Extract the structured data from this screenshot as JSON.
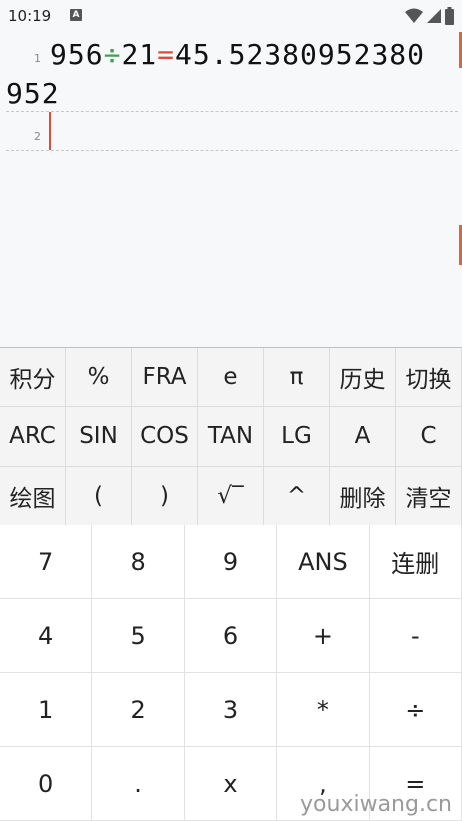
{
  "status_bar": {
    "time": "10:19",
    "notification_icon": "A",
    "icons": [
      "wifi-icon",
      "signal-icon",
      "battery-icon"
    ]
  },
  "editor": {
    "line1_number": "1",
    "line1_operand1": "956",
    "line1_op": "÷",
    "line1_operand2": "21",
    "line1_eq": "=",
    "line1_result_part1": "45.52380952380",
    "line1_result_part2": "952",
    "line2_number": "2",
    "colors": {
      "divide": "#3fa34d",
      "equals": "#e04a3a",
      "cursor": "#e04a3a"
    }
  },
  "function_keys": [
    [
      "积分",
      "%",
      "FRA",
      "e",
      "π",
      "历史",
      "切换"
    ],
    [
      "ARC",
      "SIN",
      "COS",
      "TAN",
      "LG",
      "A",
      "C"
    ],
    [
      "绘图",
      "(",
      ")",
      "√‾",
      "^",
      "删除",
      "清空"
    ]
  ],
  "number_keys": [
    [
      "7",
      "8",
      "9",
      "ANS",
      "连删"
    ],
    [
      "4",
      "5",
      "6",
      "+",
      "-"
    ],
    [
      "1",
      "2",
      "3",
      "*",
      "÷"
    ],
    [
      "0",
      ".",
      "x",
      ",",
      "="
    ]
  ],
  "watermark": "youxiwang.cn"
}
